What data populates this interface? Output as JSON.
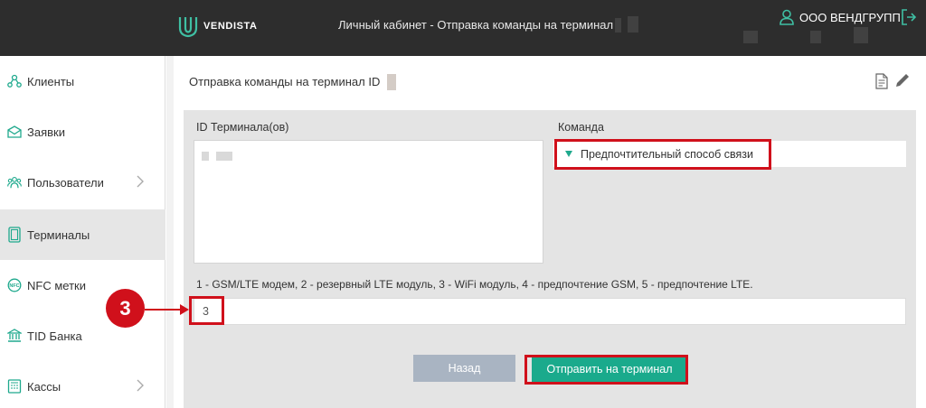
{
  "header": {
    "brand": "VENDISTA",
    "title": "Личный кабинет - Отправка команды на терминал",
    "user_name": "ООО ВЕНДГРУПП"
  },
  "sidebar": {
    "items": [
      {
        "label": "Клиенты",
        "icon": "clients-icon"
      },
      {
        "label": "Заявки",
        "icon": "envelope-icon"
      },
      {
        "label": "Пользователи",
        "icon": "users-icon",
        "has_submenu": true
      },
      {
        "label": "Терминалы",
        "icon": "terminal-icon",
        "active": true
      },
      {
        "label": "NFC метки",
        "icon": "nfc-icon"
      },
      {
        "label": "TID Банка",
        "icon": "bank-icon"
      },
      {
        "label": "Кассы",
        "icon": "cashbox-icon",
        "has_submenu": true
      }
    ]
  },
  "main": {
    "title": "Отправка команды на терминал ID",
    "ids_label": "ID Терминала(ов)",
    "command_label": "Команда",
    "command_value": "Предпочтительный способ связи",
    "hint": "1 - GSM/LTE модем, 2 - резервный LTE модуль, 3 - WiFi модуль, 4 - предпочтение GSM, 5 - предпочтение LTE.",
    "value": "3",
    "back_label": "Назад",
    "send_label": "Отправить на терминал"
  },
  "annotation": {
    "step": "3",
    "highlight_color": "#d0101b"
  },
  "colors": {
    "header_bg": "#2d2d2d",
    "accent": "#1aaa8c",
    "back_button": "#a9b4c2",
    "panel_bg": "#e4e4e4",
    "active_nav": "#e6e6e6"
  }
}
